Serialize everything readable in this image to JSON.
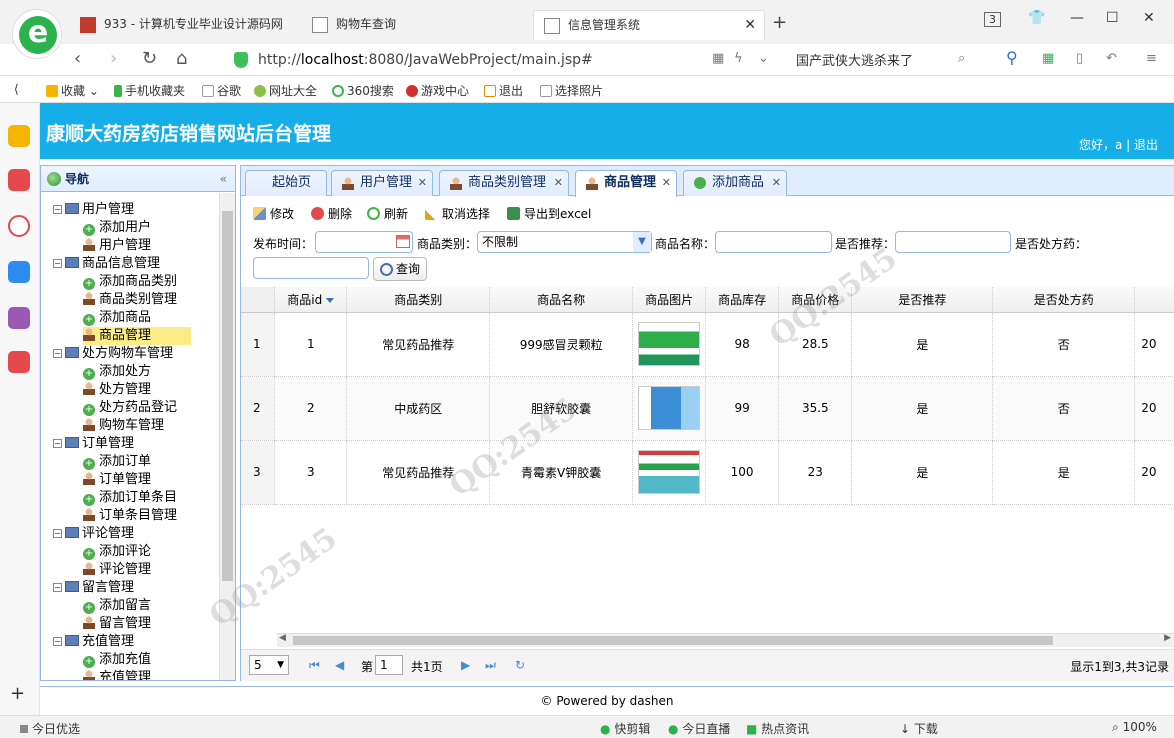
{
  "browser": {
    "tabs": [
      {
        "label": "933 - 计算机专业毕业设计源码网"
      },
      {
        "label": "购物车查询"
      },
      {
        "label": "信息管理系统",
        "active": true
      }
    ],
    "url_prefix": "http://",
    "url_host": "localhost",
    "url_rest": ":8080/JavaWebProject/main.jsp#",
    "search_text": "国产武侠大逃杀来了",
    "tab_count": "3",
    "bookmarks": [
      "收藏",
      "手机收藏夹",
      "谷歌",
      "网址大全",
      "360搜索",
      "游戏中心",
      "退出",
      "选择照片"
    ]
  },
  "app": {
    "title": "康顺大药房药店销售网站后台管理",
    "user_greeting": "您好，a | 退出"
  },
  "nav": {
    "title": "导航",
    "tree": [
      {
        "label": "用户管理",
        "type": "folder"
      },
      {
        "label": "添加用户",
        "type": "add"
      },
      {
        "label": "用户管理",
        "type": "user"
      },
      {
        "label": "商品信息管理",
        "type": "folder"
      },
      {
        "label": "添加商品类别",
        "type": "add"
      },
      {
        "label": "商品类别管理",
        "type": "user"
      },
      {
        "label": "添加商品",
        "type": "add"
      },
      {
        "label": "商品管理",
        "type": "user",
        "selected": true
      },
      {
        "label": "处方购物车管理",
        "type": "folder"
      },
      {
        "label": "添加处方",
        "type": "add"
      },
      {
        "label": "处方管理",
        "type": "user"
      },
      {
        "label": "处方药品登记",
        "type": "add"
      },
      {
        "label": "购物车管理",
        "type": "user"
      },
      {
        "label": "订单管理",
        "type": "folder"
      },
      {
        "label": "添加订单",
        "type": "add"
      },
      {
        "label": "订单管理",
        "type": "user"
      },
      {
        "label": "添加订单条目",
        "type": "add"
      },
      {
        "label": "订单条目管理",
        "type": "user"
      },
      {
        "label": "评论管理",
        "type": "folder"
      },
      {
        "label": "添加评论",
        "type": "add"
      },
      {
        "label": "评论管理",
        "type": "user"
      },
      {
        "label": "留言管理",
        "type": "folder"
      },
      {
        "label": "添加留言",
        "type": "add"
      },
      {
        "label": "留言管理",
        "type": "user"
      },
      {
        "label": "充值管理",
        "type": "folder"
      },
      {
        "label": "添加充值",
        "type": "add"
      },
      {
        "label": "充值管理",
        "type": "user"
      }
    ]
  },
  "content_tabs": [
    {
      "label": "起始页",
      "closable": false
    },
    {
      "label": "用户管理",
      "closable": true
    },
    {
      "label": "商品类别管理",
      "closable": true
    },
    {
      "label": "商品管理",
      "closable": true,
      "active": true
    },
    {
      "label": "添加商品",
      "closable": true
    }
  ],
  "toolbar": {
    "edit": "修改",
    "delete": "删除",
    "refresh": "刷新",
    "unselect": "取消选择",
    "export": "导出到excel"
  },
  "filters": {
    "publish_time_label": "发布时间：",
    "category_label": "商品类别：",
    "category_value": "不限制",
    "name_label": "商品名称：",
    "recommend_label": "是否推荐：",
    "prescription_label": "是否处方药：",
    "search_button": "查询"
  },
  "grid": {
    "columns": [
      "商品id",
      "商品类别",
      "商品名称",
      "商品图片",
      "商品库存",
      "商品价格",
      "是否推荐",
      "是否处方药",
      ""
    ],
    "rows": [
      {
        "rn": "1",
        "id": "1",
        "category": "常见药品推荐",
        "name": "999感冒灵颗粒",
        "stock": "98",
        "price": "28.5",
        "recommend": "是",
        "prescription": "否",
        "date": "20"
      },
      {
        "rn": "2",
        "id": "2",
        "category": "中成药区",
        "name": "胆舒软胶囊",
        "stock": "99",
        "price": "35.5",
        "recommend": "是",
        "prescription": "否",
        "date": "20"
      },
      {
        "rn": "3",
        "id": "3",
        "category": "常见药品推荐",
        "name": "青霉素V钾胶囊",
        "stock": "100",
        "price": "23",
        "recommend": "是",
        "prescription": "是",
        "date": "20"
      }
    ]
  },
  "pager": {
    "page_size": "5",
    "page_prefix": "第",
    "page_num": "1",
    "page_total": "共1页",
    "summary": "显示1到3,共3记录"
  },
  "footer": "© Powered by dashen",
  "statusbar": {
    "left": "今日优选",
    "items": [
      "快剪辑",
      "今日直播",
      "热点资讯",
      "下载"
    ],
    "zoom": "100%"
  }
}
